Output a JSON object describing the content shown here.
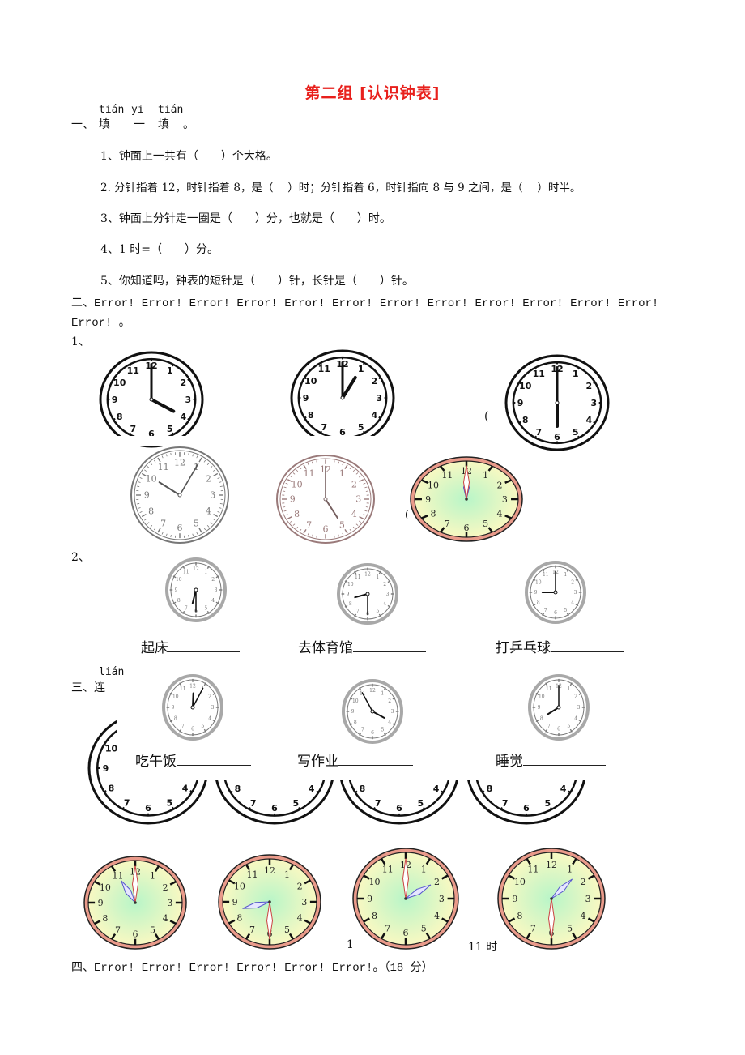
{
  "title": "第二组 [认识钟表]",
  "section1": {
    "pinyin": [
      "tián",
      "yi",
      "tián"
    ],
    "heading_prefix": "一、",
    "heading_chars": [
      "填",
      "一",
      "填"
    ],
    "heading_end": "。",
    "questions": [
      "1、钟面上一共有（　　）个大格。",
      "2. 分针指着 12，时针指着 8，是（　 ）时；分针指着 6，时针指向 8 与 9 之间，是（　 ）时半。",
      "3、钟面上分针走一圈是（　　）分，也就是（　　）时。",
      "4、1 时=（　　）分。",
      "5、你知道吗，钟表的短针是（　　）针，长针是（　　）针。"
    ]
  },
  "section2": {
    "line1": "二、Error! Error! Error! Error! Error! Error! Error! Error! Error! Error! Error! Error!",
    "line2": "Error! 。",
    "sub1": "1、",
    "sub2": "2、",
    "paren_mark": "(",
    "clocks_row1": [
      {
        "hour": 4,
        "minute": 0,
        "style": "line-art"
      },
      {
        "hour": 1,
        "minute": 0,
        "style": "line-art"
      },
      {
        "hour": 6,
        "minute": 0,
        "style": "line-art"
      }
    ],
    "clocks_row2": [
      {
        "hour": 10,
        "minute": 5,
        "style": "gray-sketch"
      },
      {
        "hour": 5,
        "minute": 0,
        "style": "pink-sketch"
      },
      {
        "hour": 12,
        "minute": 0,
        "style": "color"
      }
    ],
    "activities": [
      {
        "label": "起床",
        "hour": 6,
        "minute": 30
      },
      {
        "label": "去体育馆",
        "hour": 8,
        "minute": 30
      },
      {
        "label": "打乒乓球",
        "hour": 9,
        "minute": 0
      }
    ]
  },
  "section3": {
    "pinyin": "lián",
    "heading": "三、连",
    "activities": [
      {
        "label": "吃午饭",
        "hour": 12,
        "minute": 5
      },
      {
        "label": "写作业",
        "hour": 3,
        "minute": 55
      },
      {
        "label": "睡觉",
        "hour": 8,
        "minute": 0
      }
    ],
    "color_clocks": [
      {
        "hour": 11,
        "minute": 0
      },
      {
        "hour": 8,
        "minute": 30
      },
      {
        "hour": 2,
        "minute": 0
      },
      {
        "hour": 1,
        "minute": 30
      }
    ],
    "captions": [
      "1",
      "11 时"
    ]
  },
  "section4": {
    "heading": "四、Error! Error! Error! Error! Error! Error!。（18 分）"
  }
}
